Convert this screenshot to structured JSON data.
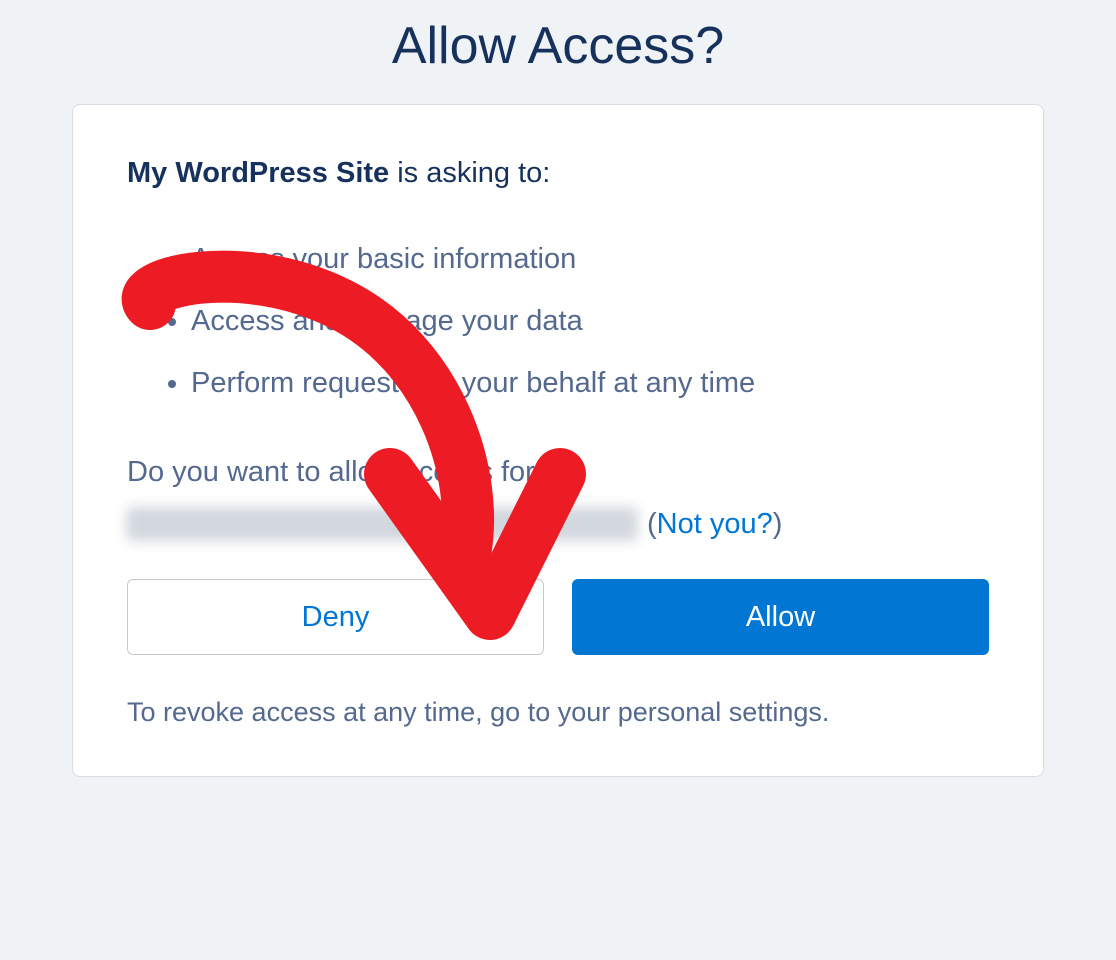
{
  "page": {
    "title": "Allow Access?"
  },
  "card": {
    "app_name": "My WordPress Site",
    "asking_suffix": " is asking to:",
    "permissions": [
      "Access your basic information",
      "Access and manage your data",
      "Perform requests on your behalf at any time"
    ],
    "allow_question": "Do you want to allow access for",
    "not_you_open": " (",
    "not_you_label": "Not you?",
    "not_you_close": ")",
    "deny_label": "Deny",
    "allow_label": "Allow",
    "revoke_note": "To revoke access at any time, go to your personal settings."
  }
}
